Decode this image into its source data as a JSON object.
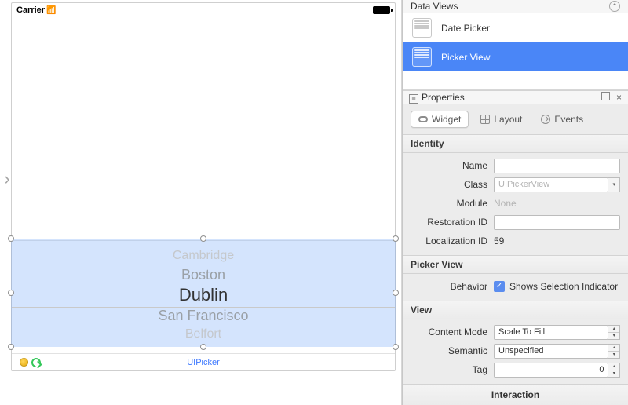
{
  "canvas": {
    "arrow_glyph": "›",
    "status": {
      "carrier": "Carrier",
      "wifi_glyph": "ᯤ"
    },
    "picker": {
      "items": [
        "Cambridge",
        "Boston",
        "Dublin",
        "San Francisco",
        "Belfort"
      ],
      "selected_index": 2
    },
    "footer_title": "UIPicker"
  },
  "inspector": {
    "data_views": {
      "title": "Data Views",
      "items": [
        {
          "label": "Date Picker",
          "selected": false
        },
        {
          "label": "Picker View",
          "selected": true
        }
      ]
    },
    "properties": {
      "title": "Properties",
      "tabs": {
        "widget": "Widget",
        "layout": "Layout",
        "events": "Events",
        "active": "widget"
      },
      "identity": {
        "group": "Identity",
        "name_label": "Name",
        "name_value": "",
        "class_label": "Class",
        "class_value": "UIPickerView",
        "module_label": "Module",
        "module_value": "None",
        "restoration_label": "Restoration ID",
        "restoration_value": "",
        "localization_label": "Localization ID",
        "localization_value": "59"
      },
      "picker_view": {
        "group": "Picker View",
        "behavior_label": "Behavior",
        "shows_indicator_label": "Shows Selection Indicator",
        "shows_indicator_checked": true
      },
      "view": {
        "group": "View",
        "content_mode_label": "Content Mode",
        "content_mode_value": "Scale To Fill",
        "semantic_label": "Semantic",
        "semantic_value": "Unspecified",
        "tag_label": "Tag",
        "tag_value": "0",
        "interaction_label": "Interaction"
      }
    }
  }
}
